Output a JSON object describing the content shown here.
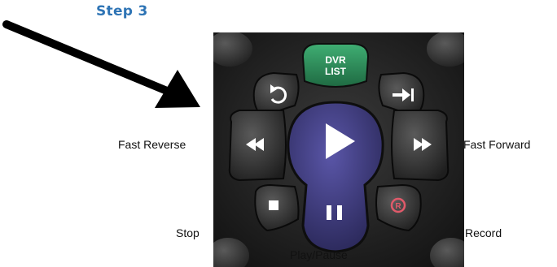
{
  "heading": "Step 3",
  "labels": {
    "fast_reverse": "Fast Reverse",
    "fast_forward": "Fast Forward",
    "stop": "Stop",
    "record": "Record",
    "play_pause": "Play/Pause"
  },
  "remote": {
    "dvr_line1": "DVR",
    "dvr_line2": "LIST",
    "buttons": [
      "replay",
      "dvr-list",
      "skip-forward",
      "rewind",
      "play",
      "fast-forward",
      "stop",
      "pause",
      "record"
    ]
  },
  "colors": {
    "heading": "#2e74b5",
    "remote_body": "#2a2a2a",
    "button": "#3a3a3a",
    "play_button": "#3d3a7a",
    "dvr_button": "#2e8a5a",
    "arrow": "#000000"
  }
}
